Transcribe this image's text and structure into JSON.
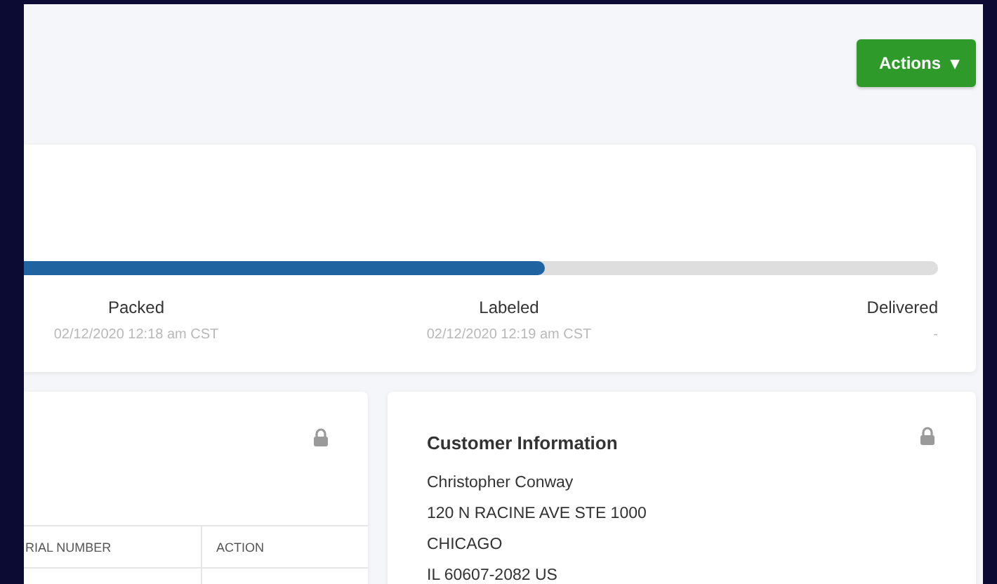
{
  "actions_button": {
    "label": "Actions",
    "caret": "▾"
  },
  "shipment_progress": {
    "level": 0.57,
    "steps": [
      {
        "label": "Packed",
        "time": "02/12/2020 12:18 am CST"
      },
      {
        "label": "Labeled",
        "time": "02/12/2020 12:19 am CST"
      },
      {
        "label": "Delivered",
        "time": "-"
      }
    ]
  },
  "items_card": {
    "locked": true,
    "table": {
      "columns": [
        "RIAL NUMBER",
        "ACTION"
      ]
    }
  },
  "customer_card": {
    "title": "Customer Information",
    "locked": true,
    "lines": [
      "Christopher Conway",
      "120 N RACINE AVE STE 1000",
      "CHICAGO",
      "IL 60607-2082 US"
    ]
  }
}
